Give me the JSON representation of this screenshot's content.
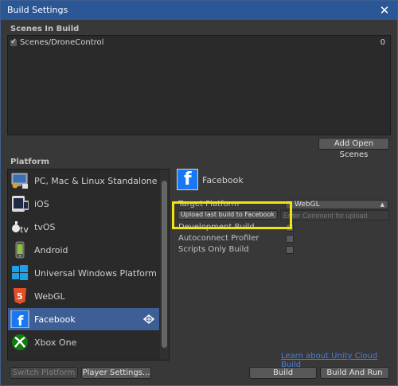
{
  "window": {
    "title": "Build Settings",
    "close_glyph": "✕"
  },
  "scenes": {
    "label": "Scenes In Build",
    "items": [
      {
        "name": "Scenes/DroneControl",
        "index": "0",
        "checked": true
      }
    ],
    "add_open_scenes": "Add Open Scenes"
  },
  "platform": {
    "label": "Platform",
    "items": [
      {
        "label": "PC, Mac & Linux Standalone",
        "icon": "pc-mac-linux-icon"
      },
      {
        "label": "iOS",
        "icon": "ios-icon"
      },
      {
        "label": "tvOS",
        "icon": "tvos-icon",
        "icon_text": "tv"
      },
      {
        "label": "Android",
        "icon": "android-icon"
      },
      {
        "label": "Universal Windows Platform",
        "icon": "windows-icon"
      },
      {
        "label": "WebGL",
        "icon": "html5-icon",
        "icon_text": "5"
      },
      {
        "label": "Facebook",
        "icon": "facebook-icon",
        "selected": true,
        "icon_text": "f"
      },
      {
        "label": "Xbox One",
        "icon": "xbox-icon"
      }
    ]
  },
  "details": {
    "title": "Facebook",
    "icon_text": "f",
    "target_platform_label": "Target Platform",
    "target_platform_value": "WebGL",
    "upload_button": "Upload last build to Facebook",
    "comment_placeholder": "Enter Comment for upload",
    "development_build": "Development Build",
    "autoconnect_profiler": "Autoconnect Profiler",
    "scripts_only_build": "Scripts Only Build"
  },
  "footer": {
    "learn_link": "Learn about Unity Cloud Build",
    "switch_platform": "Switch Platform",
    "player_settings": "Player Settings...",
    "build": "Build",
    "build_and_run": "Build And Run"
  },
  "colors": {
    "selection": "#3e5f96",
    "titlebar": "#2b5797",
    "highlight": "#f2e40a",
    "link": "#4c7dd6"
  }
}
